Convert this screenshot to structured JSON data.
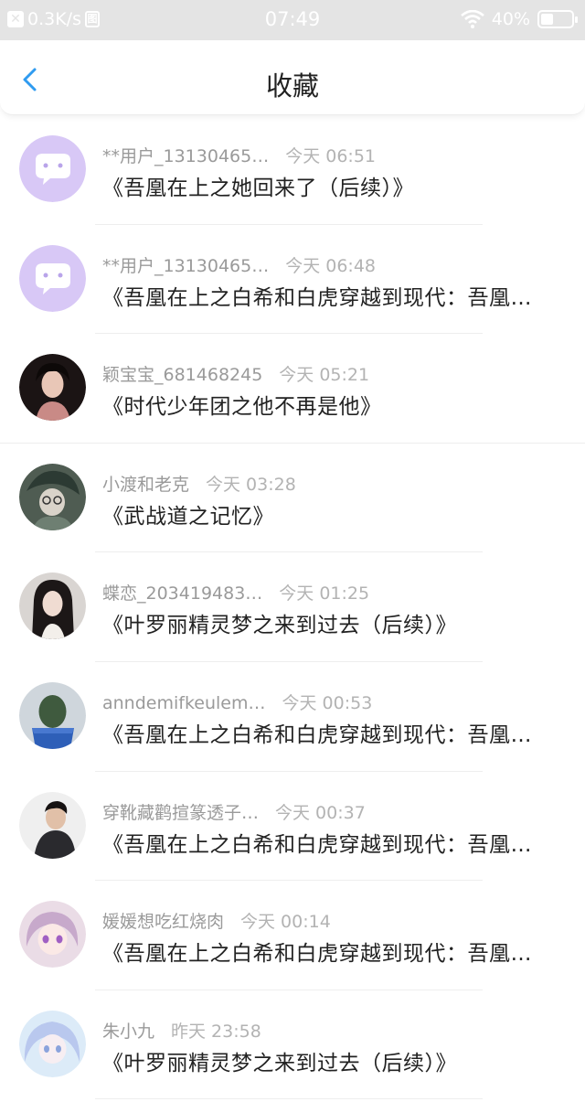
{
  "status_bar": {
    "speed": "0.3K/s",
    "box_icon": "图",
    "time": "07:49",
    "battery": "40%",
    "battery_level": 0.4
  },
  "nav": {
    "title": "收藏"
  },
  "items": [
    {
      "user": "**用户_13130465…",
      "time": "今天 06:51",
      "title": "《吾凰在上之她回来了（后续）》",
      "avatar": "purple-chat-avatar"
    },
    {
      "user": "**用户_13130465…",
      "time": "今天 06:48",
      "title": "《吾凰在上之白希和白虎穿越到现代：吾凰…",
      "avatar": "purple-chat-avatar"
    },
    {
      "user": "颖宝宝_681468245",
      "time": "今天 05:21",
      "title": "《时代少年团之他不再是他》",
      "avatar": "photo-avatar"
    },
    {
      "user": "小渡和老克",
      "time": "今天 03:28",
      "title": "《武战道之记忆》",
      "avatar": "photo-avatar"
    },
    {
      "user": "蝶恋_203419483…",
      "time": "今天 01:25",
      "title": "《叶罗丽精灵梦之来到过去（后续）》",
      "avatar": "photo-avatar"
    },
    {
      "user": "anndemifkeulem…",
      "time": "今天 00:53",
      "title": "《吾凰在上之白希和白虎穿越到现代：吾凰…",
      "avatar": "cactus-avatar"
    },
    {
      "user": "穿靴藏鹳揎篆透子…",
      "time": "今天 00:37",
      "title": "《吾凰在上之白希和白虎穿越到现代：吾凰…",
      "avatar": "photo-avatar"
    },
    {
      "user": "媛媛想吃红烧肉",
      "time": "今天 00:14",
      "title": "《吾凰在上之白希和白虎穿越到现代：吾凰…",
      "avatar": "anime-avatar"
    },
    {
      "user": "朱小九",
      "time": "昨天 23:58",
      "title": "《叶罗丽精灵梦之来到过去（后续）》",
      "avatar": "anime-avatar"
    }
  ],
  "colors": {
    "accent": "#2f9bf0",
    "purple_avatar": "#d8c8f6"
  }
}
